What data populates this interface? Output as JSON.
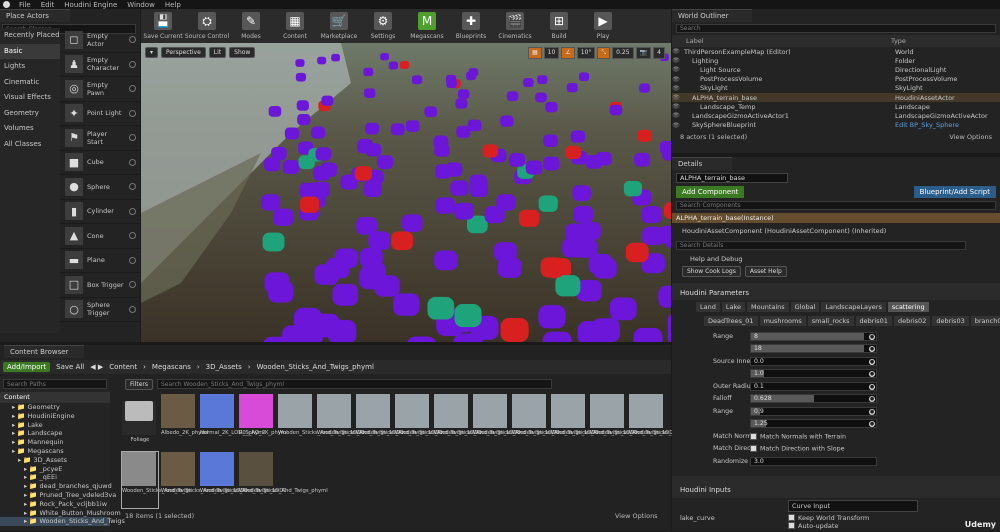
{
  "menu": {
    "items": [
      "File",
      "Edit",
      "Houdini Engine",
      "Window",
      "Help"
    ]
  },
  "place_actors": {
    "tab": "Place Actors",
    "search_placeholder": "Search Classes",
    "categories": [
      "Recently Placed",
      "Basic",
      "Lights",
      "Cinematic",
      "Visual Effects",
      "Geometry",
      "Volumes",
      "All Classes"
    ],
    "selected_category": "Basic",
    "items": [
      "Empty Actor",
      "Empty Character",
      "Empty Pawn",
      "Point Light",
      "Player Start",
      "Cube",
      "Sphere",
      "Cylinder",
      "Cone",
      "Plane",
      "Box Trigger",
      "Sphere Trigger"
    ]
  },
  "toolbar": {
    "buttons": [
      "Save Current",
      "Source Control",
      "Modes",
      "Content",
      "Marketplace",
      "Settings",
      "Megascans",
      "Blueprints",
      "Cinematics",
      "Build",
      "Play"
    ]
  },
  "viewport": {
    "perspective": "Perspective",
    "lit": "Lit",
    "show": "Show",
    "right_controls": [
      "10",
      "10°",
      "0.25",
      "4"
    ]
  },
  "content_browser": {
    "tab": "Content Browser",
    "add_import": "Add/Import",
    "save_all": "Save All",
    "breadcrumb": [
      "Content",
      "Megascans",
      "3D_Assets",
      "Wooden_Sticks_And_Twigs_phyml"
    ],
    "search_paths": "Search Paths",
    "filters": "Filters",
    "search_placeholder": "Search Wooden_Sticks_And_Twigs_phyml",
    "tree": [
      "Content",
      "Geometry",
      "HoudiniEngine",
      "Lake",
      "Landscape",
      "Mannequin",
      "Megascans",
      "3D_Assets",
      "_pcyeE",
      "_qEEi",
      "dead_branches_qjuwd",
      "Pruned_Tree_vdeled3va",
      "Rock_Pack_vcljbb1iw",
      "White_Button_Mushroom",
      "Wooden_Sticks_And_Twigs"
    ],
    "assets_row1": [
      "Foliage",
      "Albedo_2K_phyml",
      "Normal_2K_LOD0_phyml",
      "R_S_AO_2K_phyml",
      "Wooden_Sticks_And_Twigs_LOD0",
      "Wooden_Sticks_And_Twigs_LOD0",
      "Wooden_Sticks_And_Twigs_LOD0",
      "Wooden_Sticks_And_Twigs_LOD0",
      "Wooden_Sticks_And_Twigs_LOD0",
      "Wooden_Sticks_And_Twigs_LOD0",
      "Wooden_Sticks_And_Twigs_LOD0",
      "Wooden_Sticks_And_Twigs_LOD0",
      "Wooden_Sticks_And_Twigs_LOD0",
      "Wooden_Sticks_And_Twigs_LOD0"
    ],
    "assets_row2": [
      "Wooden_Sticks_And_Twigs",
      "Wooden_Sticks_And_Twigs_LOD0",
      "Wooden_Sticks_And_Twigs_LOD0",
      "Wooden_Sticks_And_Twigs_phyml"
    ],
    "footer": "18 items (1 selected)",
    "view_options": "View Options"
  },
  "outliner": {
    "tab": "World Outliner",
    "search_placeholder": "Search",
    "col_label": "Label",
    "col_type": "Type",
    "rows": [
      {
        "label": "ThirdPersonExampleMap (Editor)",
        "type": "World",
        "indent": 0
      },
      {
        "label": "Lighting",
        "type": "Folder",
        "indent": 1
      },
      {
        "label": "Light Source",
        "type": "DirectionalLight",
        "indent": 2
      },
      {
        "label": "PostProcessVolume",
        "type": "PostProcessVolume",
        "indent": 2
      },
      {
        "label": "SkyLight",
        "type": "SkyLight",
        "indent": 2
      },
      {
        "label": "ALPHA_terrain_base",
        "type": "HoudiniAssetActor",
        "indent": 1,
        "sel": true
      },
      {
        "label": "Landscape_Temp",
        "type": "Landscape",
        "indent": 2
      },
      {
        "label": "LandscapeGizmoActiveActor1",
        "type": "LandscapeGizmoActiveActor",
        "indent": 1
      },
      {
        "label": "SkySphereBlueprint",
        "type": "Edit BP_Sky_Sphere",
        "indent": 1
      }
    ],
    "footer": "8 actors (1 selected)",
    "view_options": "View Options"
  },
  "details": {
    "tab": "Details",
    "name": "ALPHA_terrain_base",
    "add_component": "Add Component",
    "blueprint_btn": "Blueprint/Add Script",
    "search_components": "Search Components",
    "instance": "ALPHA_terrain_base(Instance)",
    "component": "HoudiniAssetComponent (HoudiniAssetComponent) (Inherited)",
    "search_details": "Search Details",
    "help_debug": "Help and Debug",
    "show_cook": "Show Cook Logs",
    "asset_help": "Asset Help",
    "houdini_params": "Houdini Parameters",
    "tabs": [
      "Land",
      "Lake",
      "Mountains",
      "Global",
      "LandscapeLayers",
      "scattering"
    ],
    "subtabs": [
      "DeadTrees_01",
      "mushrooms",
      "small_rocks",
      "debris01",
      "debris02",
      "debris03",
      "branch01"
    ],
    "params": [
      {
        "label": "Range",
        "v1": "8",
        "v2": "18",
        "fill1": 0.9,
        "fill2": 0.9
      },
      {
        "label": "Source Inner Radius Ratio",
        "v1": "0.0",
        "v2": "1.0",
        "fill1": 0,
        "fill2": 0.1
      },
      {
        "label": "Outer Radius",
        "v1": "0.1"
      },
      {
        "label": "Falloff",
        "v1": "0.628",
        "fill1": 0.5
      },
      {
        "label": "Range",
        "v1": "0.9",
        "v2": "1.25",
        "fill1": 0.07,
        "fill2": 0.12
      }
    ],
    "match_normals_label": "Match Normals with Terra",
    "match_normals": "Match Normals with Terrain",
    "match_dir_label": "Match Direction with Slope",
    "match_dir": "Match Direction with Slope",
    "randomize_label": "Randomize Up",
    "randomize": "3.0",
    "houdini_inputs": "Houdini Inputs",
    "lake_curve": "lake_curve",
    "curve_input": "Curve Input",
    "keep_world": "Keep World Transform",
    "auto_update": "Auto-update"
  },
  "watermark": "Udemy"
}
